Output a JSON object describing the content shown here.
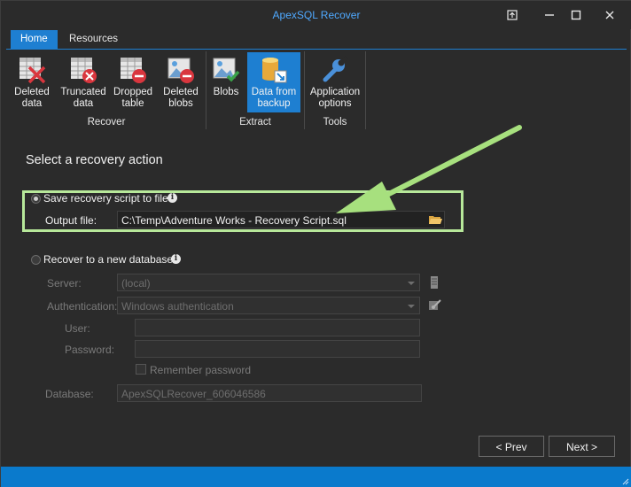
{
  "window": {
    "title": "ApexSQL Recover",
    "controls": [
      "restore-icon",
      "minimize-icon",
      "maximize-icon",
      "close-icon"
    ]
  },
  "tabs": [
    {
      "label": "Home",
      "active": true
    },
    {
      "label": "Resources",
      "active": false
    }
  ],
  "ribbon": {
    "groups": [
      {
        "label": "Recover",
        "buttons": [
          {
            "line1": "Deleted",
            "line2": "data",
            "icon": "deleted-data-icon"
          },
          {
            "line1": "Truncated",
            "line2": "data",
            "icon": "truncated-data-icon"
          },
          {
            "line1": "Dropped",
            "line2": "table",
            "icon": "dropped-table-icon"
          },
          {
            "line1": "Deleted",
            "line2": "blobs",
            "icon": "deleted-blobs-icon"
          }
        ]
      },
      {
        "label": "Extract",
        "buttons": [
          {
            "line1": "Blobs",
            "line2": "",
            "icon": "blobs-icon"
          },
          {
            "line1": "Data from",
            "line2": "backup",
            "icon": "data-from-backup-icon",
            "selected": true
          }
        ]
      },
      {
        "label": "Tools",
        "buttons": [
          {
            "line1": "Application",
            "line2": "options",
            "icon": "wrench-icon"
          }
        ]
      }
    ]
  },
  "main": {
    "heading": "Select a recovery action",
    "save_option": {
      "label": "Save recovery script to file",
      "checked": true,
      "output_label": "Output file:",
      "output_value": "C:\\Temp\\Adventure Works - Recovery Script.sql"
    },
    "new_db_option": {
      "label": "Recover to a new database",
      "checked": false,
      "server_label": "Server:",
      "server_value": "(local)",
      "auth_label": "Authentication:",
      "auth_value": "Windows authentication",
      "user_label": "User:",
      "user_value": "",
      "password_label": "Password:",
      "password_value": "",
      "remember_label": "Remember password",
      "remember_checked": false,
      "database_label": "Database:",
      "database_value": "ApexSQLRecover_606046586"
    }
  },
  "footer": {
    "prev_label": "< Prev",
    "next_label": "Next >"
  },
  "colors": {
    "accent": "#1e7fd1",
    "title": "#4fa9ff",
    "highlight": "#b7e89a",
    "statusbar": "#0a7acc"
  }
}
